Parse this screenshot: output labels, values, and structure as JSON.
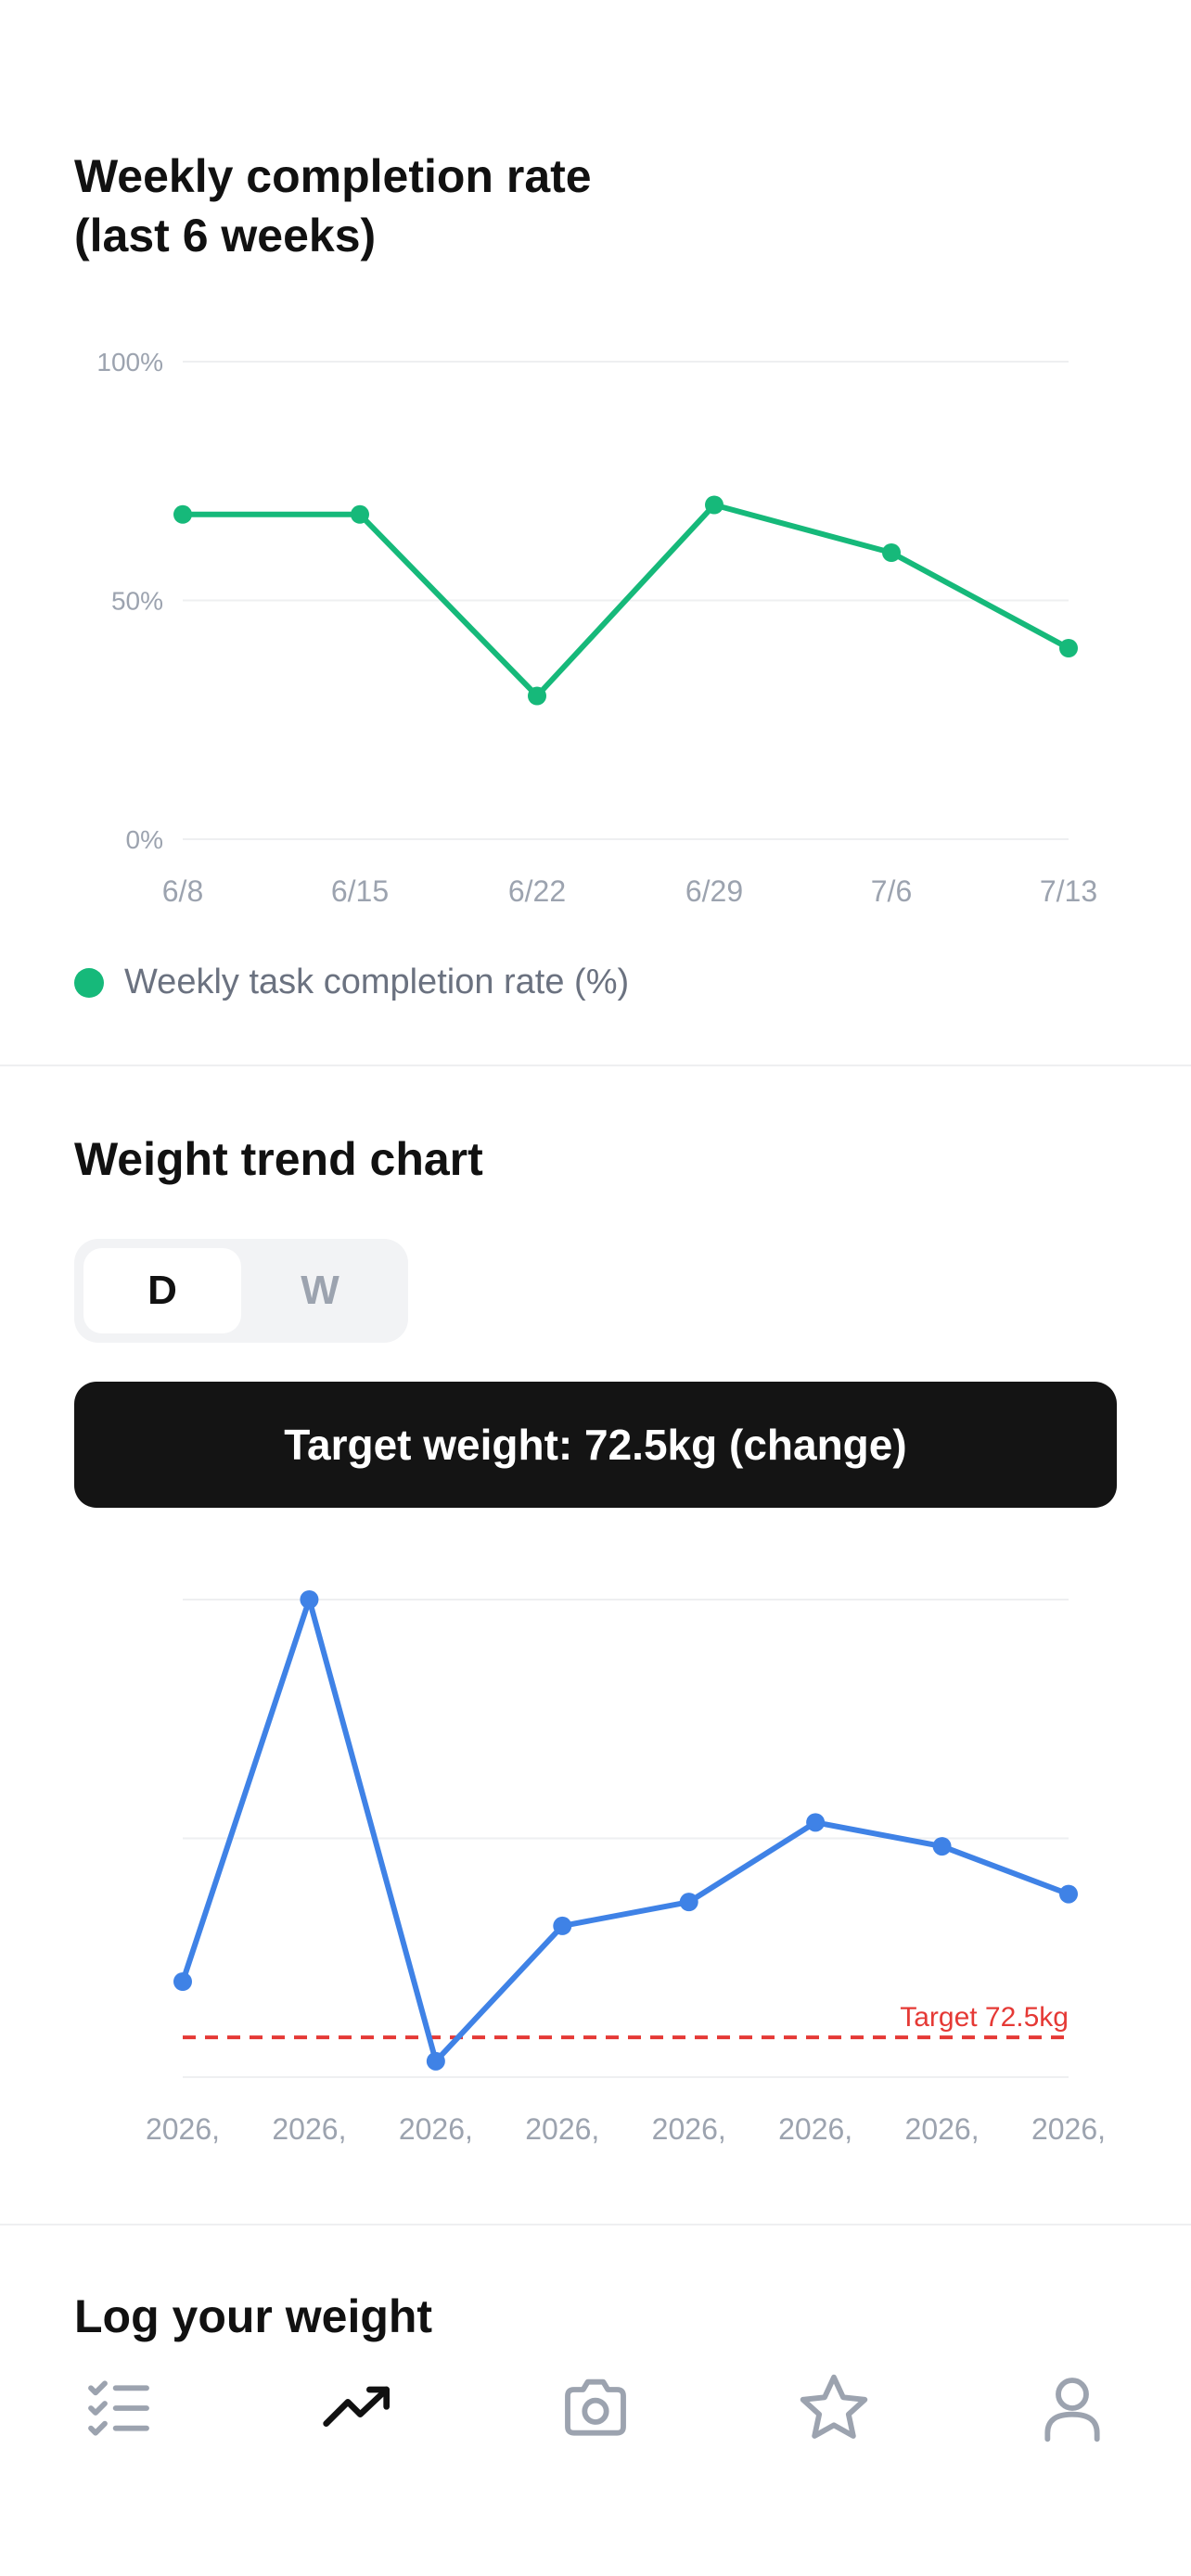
{
  "completion_section": {
    "title_line1": "Weekly completion rate",
    "title_line2": "(last 6 weeks)",
    "legend_label": "Weekly task completion rate (%)",
    "color": "#16b97a"
  },
  "weight_section": {
    "title": "Weight trend chart",
    "toggle": {
      "day_label": "D",
      "week_label": "W",
      "selected": "D"
    },
    "target_button_label": "Target weight: 72.5kg (change)",
    "line_color": "#3f82e6",
    "target_color": "#e53935"
  },
  "log_section": {
    "title": "Log your weight"
  },
  "tabbar": {
    "active": "trend",
    "items": [
      {
        "icon": "checklist-icon"
      },
      {
        "icon": "trend-up-icon"
      },
      {
        "icon": "camera-icon"
      },
      {
        "icon": "star-icon"
      },
      {
        "icon": "profile-icon"
      }
    ]
  },
  "chart_data": [
    {
      "type": "line",
      "title": "Weekly completion rate (last 6 weeks)",
      "categories": [
        "6/8",
        "6/15",
        "6/22",
        "6/29",
        "7/6",
        "7/13"
      ],
      "series": [
        {
          "name": "Weekly task completion rate (%)",
          "values": [
            68,
            68,
            30,
            70,
            60,
            40
          ]
        }
      ],
      "ylim": [
        0,
        100
      ],
      "y_ticks": [
        "0%",
        "50%",
        "100%"
      ],
      "grid": true,
      "legend": "bottom-left"
    },
    {
      "type": "line",
      "title": "Weight trend chart",
      "categories": [
        "2026,",
        "2026,",
        "2026,",
        "2026,",
        "2026,",
        "2026,",
        "2026,",
        "2026,"
      ],
      "series": [
        {
          "values": [
            73.2,
            78.0,
            72.2,
            73.9,
            74.2,
            75.2,
            74.9,
            74.3
          ]
        }
      ],
      "target": {
        "value": 72.5,
        "label": "Target 72.5kg"
      },
      "ylim": [
        72.0,
        78.0
      ],
      "grid": true
    }
  ]
}
